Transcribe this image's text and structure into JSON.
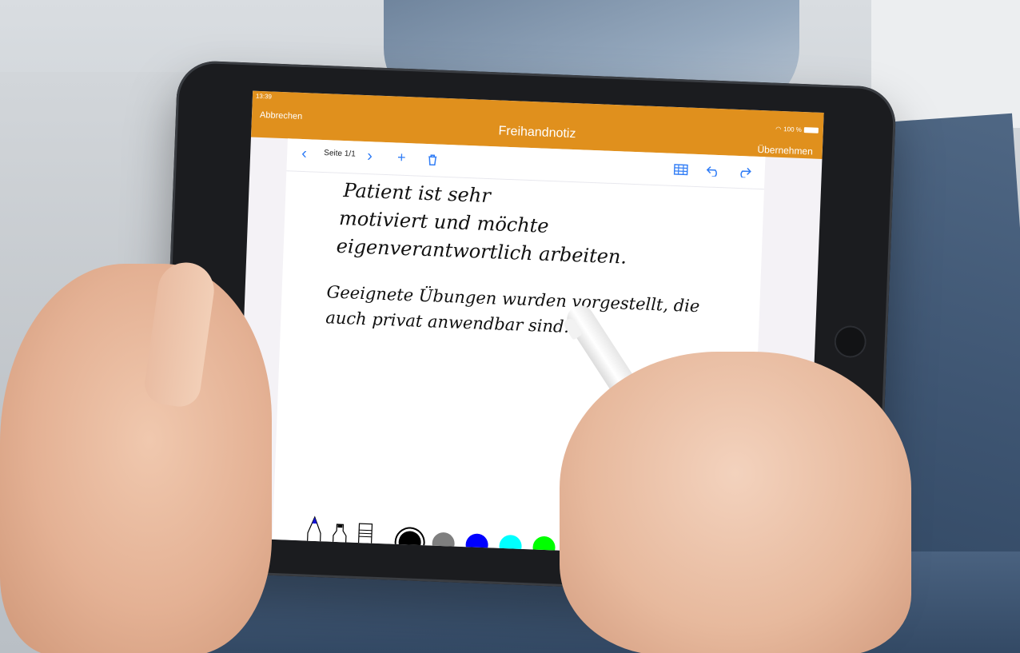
{
  "status": {
    "time": "13:39",
    "battery": "100 %"
  },
  "nav": {
    "cancel_label": "Abbrechen",
    "title": "Freihandnotiz",
    "apply_label": "Übernehmen"
  },
  "toolbar": {
    "prev_icon": "chevron-left-icon",
    "page_label": "Seite 1/1",
    "next_icon": "chevron-right-icon",
    "add_icon": "plus-icon",
    "delete_icon": "trash-icon",
    "grid_icon": "grid-icon",
    "undo_icon": "undo-icon",
    "redo_icon": "redo-icon"
  },
  "note": {
    "lines": [
      "Patient ist sehr",
      "motiviert und möchte",
      "eigenverantwortlich arbeiten.",
      "Geeignete Übungen wurden vorgestellt, die",
      "auch privat anwendbar sind."
    ]
  },
  "pens": [
    "pen-icon",
    "marker-icon",
    "eraser-icon"
  ],
  "colors": [
    "#000000",
    "#7f7f7f",
    "#0000ff",
    "#00ffff",
    "#00ff00"
  ],
  "selected_color": "#000000",
  "accent": "#e0901d"
}
